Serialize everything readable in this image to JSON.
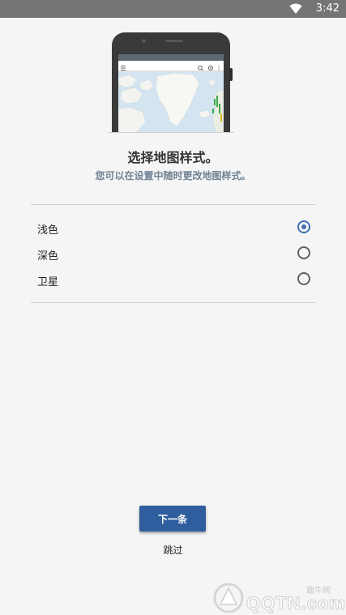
{
  "status_bar": {
    "time": "3:42",
    "wifi_icon": "wifi-icon",
    "background": "#757575"
  },
  "illustration": {
    "phone_mockup": "map-preview"
  },
  "header": {
    "title": "选择地图样式。",
    "subtitle": "您可以在设置中随时更改地图样式。"
  },
  "options": [
    {
      "label": "浅色",
      "selected": true
    },
    {
      "label": "深色",
      "selected": false
    },
    {
      "label": "卫星",
      "selected": false
    }
  ],
  "actions": {
    "next_label": "下一条",
    "skip_label": "跳过"
  },
  "watermark": {
    "small_text": "趣牛网",
    "text": "QQTN.com"
  },
  "colors": {
    "accent": "#3f6fb0",
    "button": "#2f5e9e",
    "subtitle": "#6f8394"
  }
}
